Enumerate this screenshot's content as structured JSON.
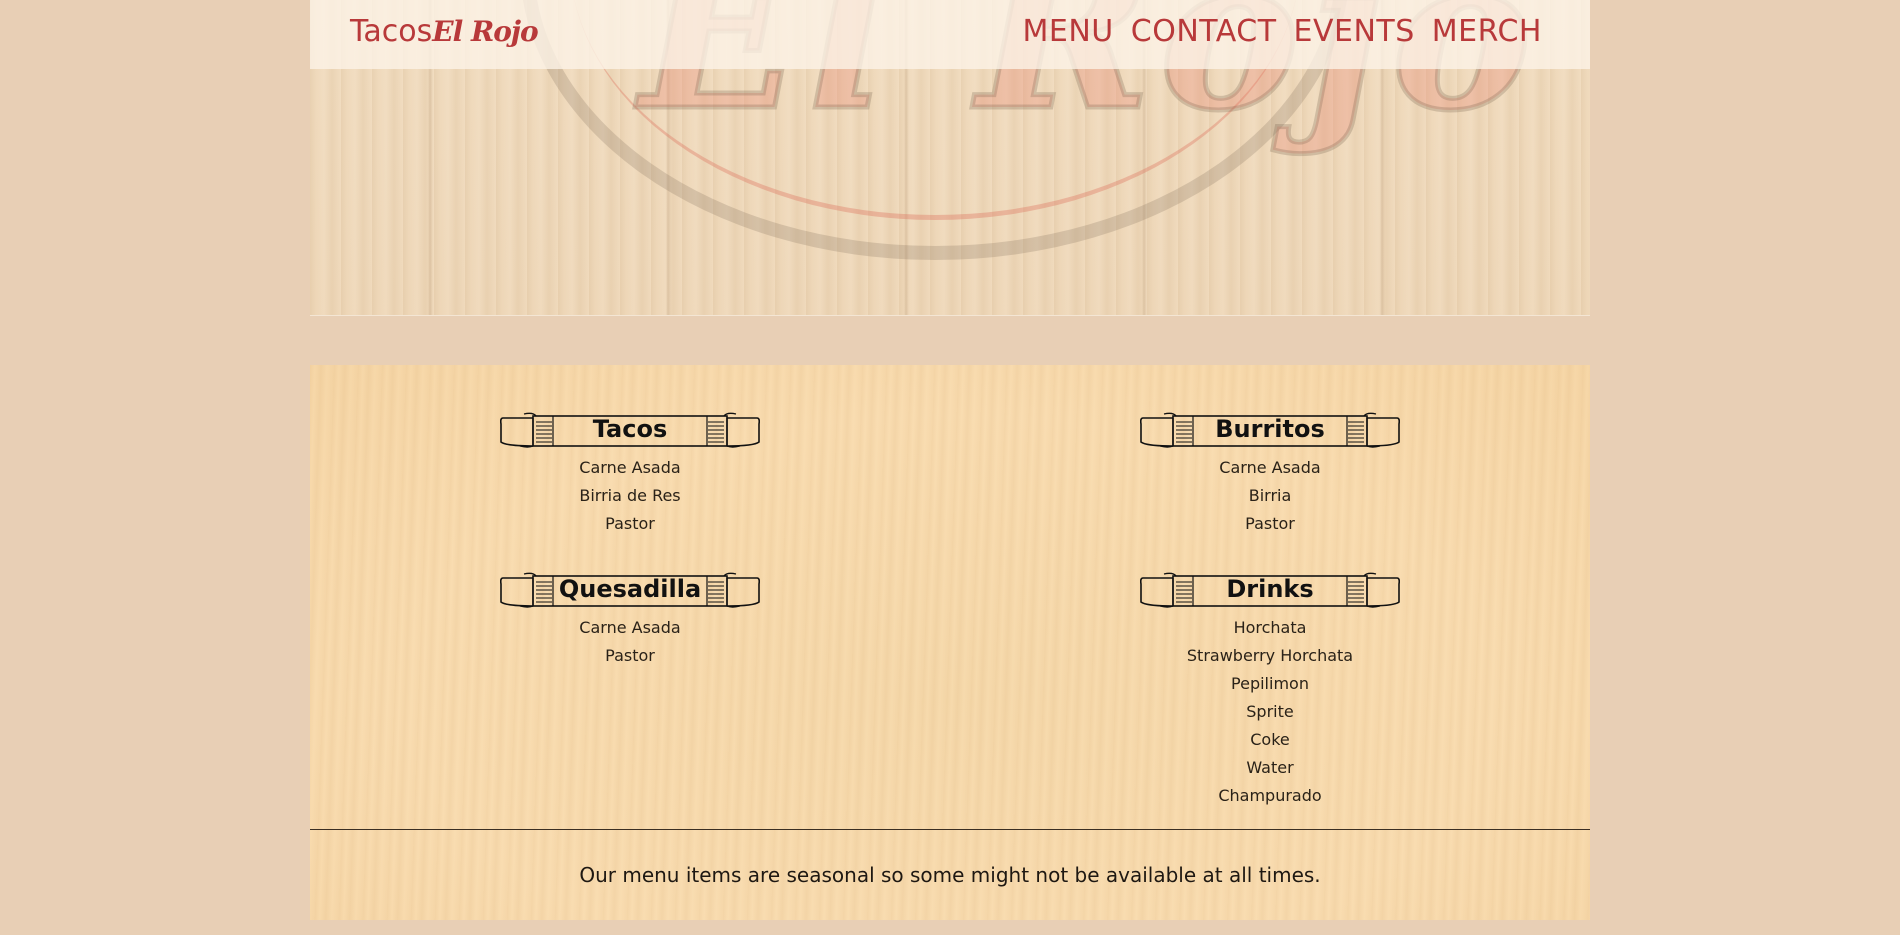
{
  "header": {
    "brand_first": "Tacos",
    "brand_second": "El Rojo",
    "nav": [
      "MENU",
      "CONTACT",
      "EVENTS",
      "MERCH"
    ]
  },
  "hero": {
    "watermark_text": "El Rojo"
  },
  "menu": {
    "tacos": {
      "title": "Tacos",
      "items": [
        "Carne Asada",
        "Birria de Res",
        "Pastor"
      ]
    },
    "burritos": {
      "title": "Burritos",
      "items": [
        "Carne Asada",
        "Birria",
        "Pastor"
      ]
    },
    "quesadilla": {
      "title": "Quesadilla",
      "items": [
        "Carne Asada",
        "Pastor"
      ]
    },
    "drinks": {
      "title": "Drinks",
      "items": [
        "Horchata",
        "Strawberry Horchata",
        "Pepilimon",
        "Sprite",
        "Coke",
        "Water",
        "Champurado"
      ]
    },
    "note": "Our menu items are seasonal so some might not be available at all times."
  },
  "colors": {
    "brand_red": "#b8393a",
    "page_bg": "#e8cfb5",
    "panel_bg": "#f9dcb0"
  }
}
